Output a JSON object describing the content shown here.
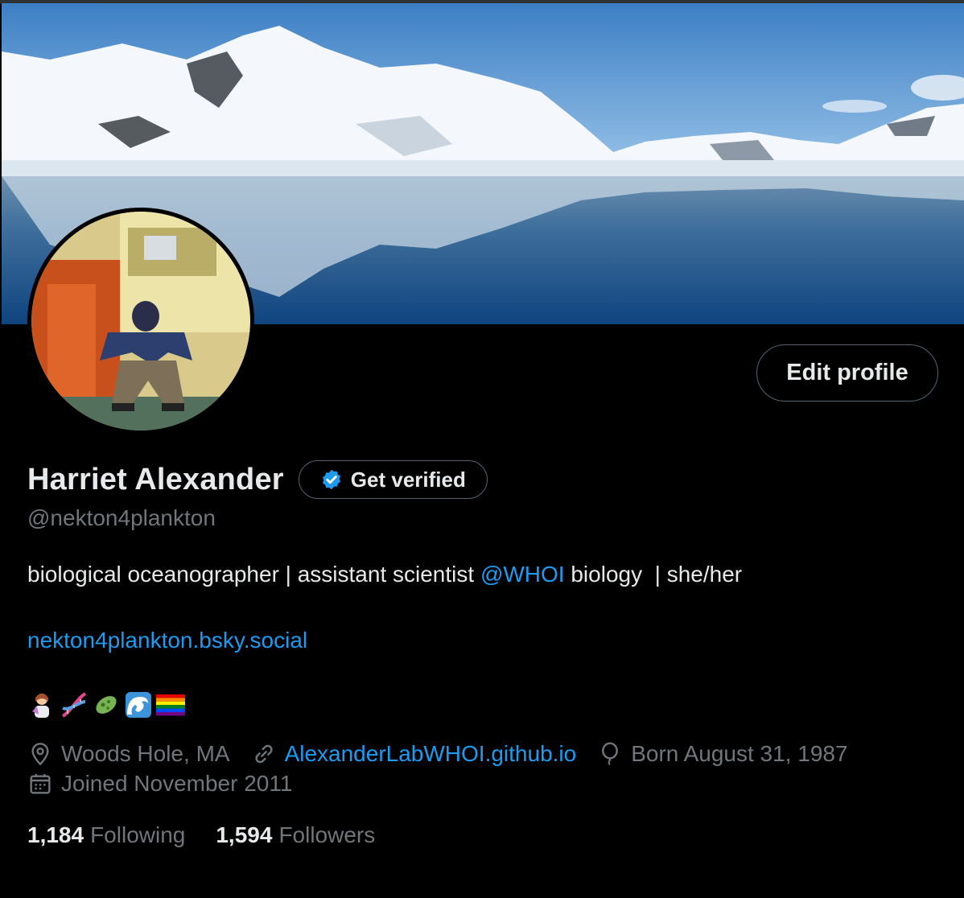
{
  "profile": {
    "name": "Harriet Alexander",
    "handle": "@nekton4plankton",
    "edit_label": "Edit profile",
    "verify_label": "Get verified",
    "bio_prefix": "biological oceanographer | assistant scientist ",
    "bio_mention": "@WHOI",
    "bio_suffix": " biology  | she/her",
    "bio_link": "nekton4plankton.bsky.social",
    "emojis": [
      "woman-scientist",
      "dna",
      "microbe",
      "water-wave",
      "rainbow-flag"
    ],
    "location": "Woods Hole, MA",
    "website": "AlexanderLabWHOI.github.io",
    "birthday": "Born August 31, 1987",
    "joined": "Joined November 2011",
    "following_count": "1,184",
    "following_label": "Following",
    "followers_count": "1,594",
    "followers_label": "Followers"
  },
  "colors": {
    "accent": "#1d9bf0",
    "muted": "#71767b",
    "text": "#e7e9ea",
    "background": "#000000"
  },
  "icons": {
    "location": "location-pin-icon",
    "website": "link-icon",
    "birthday": "balloon-icon",
    "joined": "calendar-icon",
    "verified": "verified-badge-icon"
  }
}
